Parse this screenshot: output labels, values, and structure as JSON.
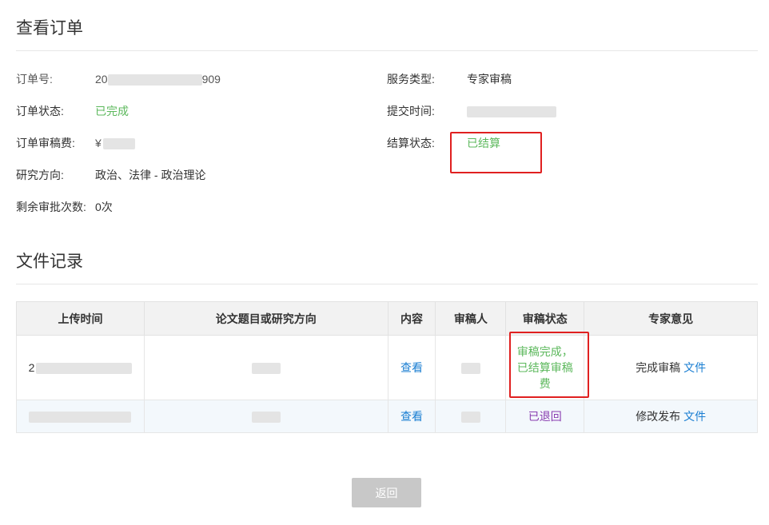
{
  "order": {
    "section_title": "查看订单",
    "fields": {
      "order_no_label": "订单号:",
      "order_no_value_start": "20",
      "order_no_value_end": "909",
      "status_label": "订单状态:",
      "status_value": "已完成",
      "fee_label": "订单审稿费:",
      "fee_currency": "¥",
      "direction_label": "研究方向:",
      "direction_value": "政治、法律 - 政治理论",
      "remaining_label": "剩余审批次数:",
      "remaining_value": "0次",
      "service_label": "服务类型:",
      "service_value": "专家审稿",
      "submit_label": "提交时间:",
      "settle_label": "结算状态:",
      "settle_value": "已结算"
    }
  },
  "files": {
    "section_title": "文件记录",
    "columns": [
      "上传时间",
      "论文题目或研究方向",
      "内容",
      "审稿人",
      "审稿状态",
      "专家意见"
    ],
    "rows": [
      {
        "upload_time": "2",
        "content_link": "查看",
        "status": "审稿完成，已结算审稿费",
        "opinion_text": "完成审稿",
        "opinion_link": "文件"
      },
      {
        "upload_time": "",
        "content_link": "查看",
        "status": "已退回",
        "opinion_text": "修改发布",
        "opinion_link": "文件"
      }
    ]
  },
  "actions": {
    "back_label": "返回"
  },
  "colors": {
    "success": "#5cb85c",
    "link": "#1a7ed2",
    "returned": "#8a3db0",
    "highlight_box": "#e02020",
    "button_disabled": "#c8c8c8"
  }
}
